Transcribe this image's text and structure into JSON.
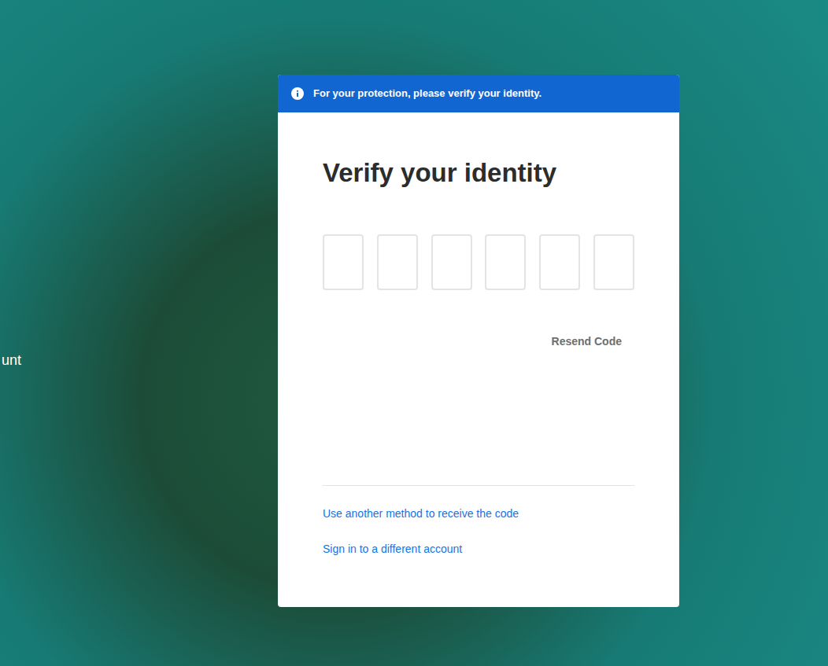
{
  "page": {
    "side_text": "unt"
  },
  "banner": {
    "text": "For your protection, please verify your identity."
  },
  "heading": "Verify your identity",
  "code_boxes": [
    {
      "value": ""
    },
    {
      "value": ""
    },
    {
      "value": ""
    },
    {
      "value": ""
    },
    {
      "value": ""
    },
    {
      "value": ""
    }
  ],
  "resend": "Resend Code",
  "links": [
    "Use another method to receive the code",
    "Sign in to a different account"
  ]
}
